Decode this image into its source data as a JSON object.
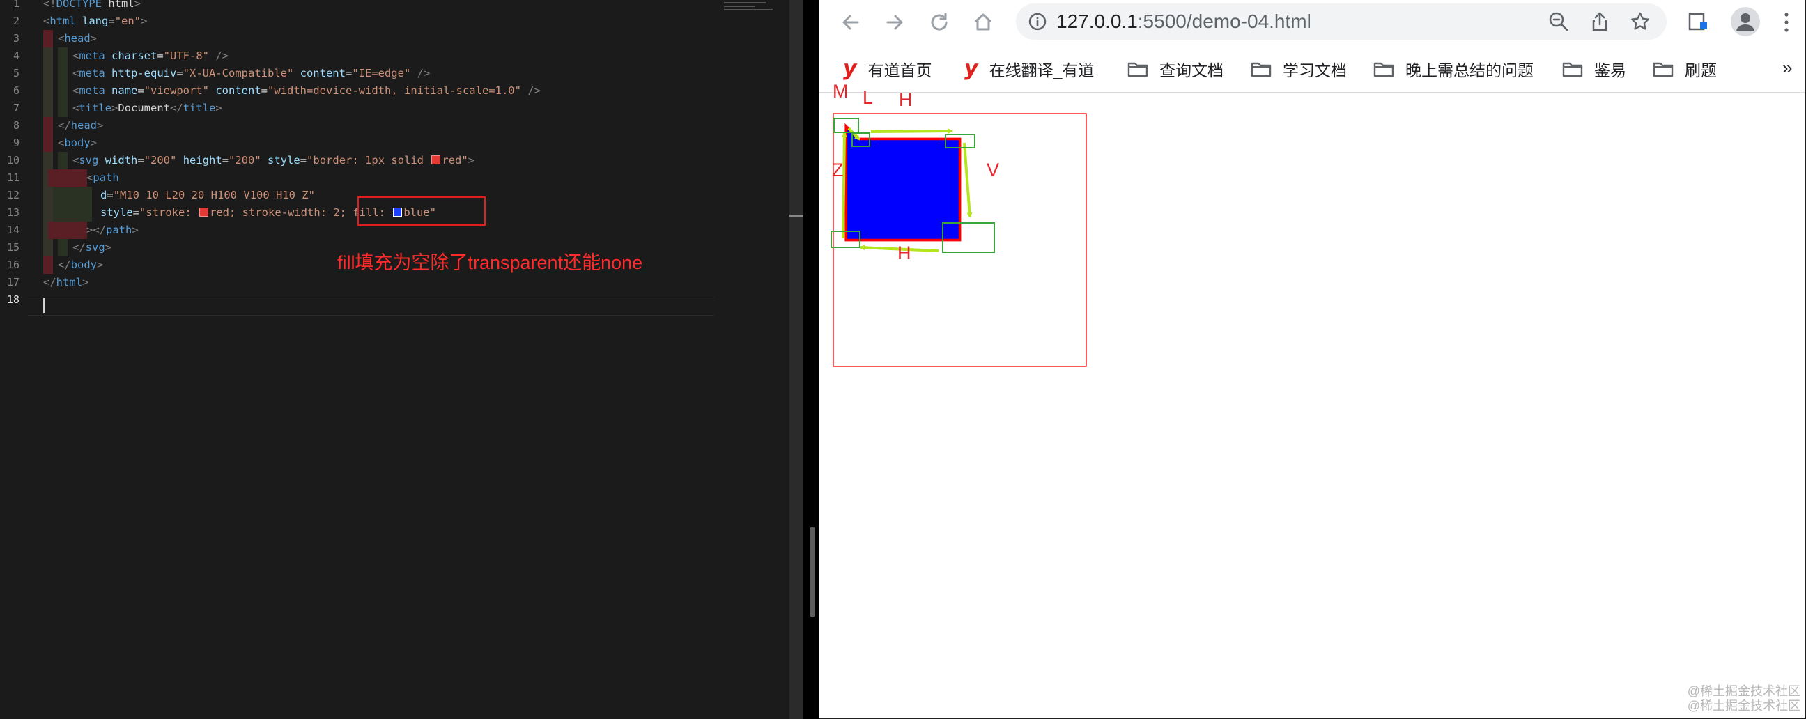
{
  "editor": {
    "lines": [
      {
        "n": "1",
        "parts": [
          [
            "pun",
            "<!"
          ],
          [
            "tag",
            "DOCTYPE"
          ],
          [
            "txt",
            " html"
          ],
          [
            "pun",
            ">"
          ]
        ]
      },
      {
        "n": "2",
        "parts": [
          [
            "pun",
            "<"
          ],
          [
            "tag",
            "html"
          ],
          [
            "attr",
            " lang"
          ],
          [
            "txt",
            "="
          ],
          [
            "str",
            "\"en\""
          ],
          [
            "pun",
            ">"
          ]
        ]
      },
      {
        "n": "3",
        "parts": [
          [
            "pun",
            "<"
          ],
          [
            "tag",
            "head"
          ],
          [
            "pun",
            ">"
          ]
        ]
      },
      {
        "n": "4",
        "parts": [
          [
            "pun",
            "<"
          ],
          [
            "tag",
            "meta"
          ],
          [
            "attr",
            " charset"
          ],
          [
            "txt",
            "="
          ],
          [
            "str",
            "\"UTF-8\""
          ],
          [
            "pun",
            " />"
          ]
        ]
      },
      {
        "n": "5",
        "parts": [
          [
            "pun",
            "<"
          ],
          [
            "tag",
            "meta"
          ],
          [
            "attr",
            " http-equiv"
          ],
          [
            "txt",
            "="
          ],
          [
            "str",
            "\"X-UA-Compatible\""
          ],
          [
            "attr",
            " content"
          ],
          [
            "txt",
            "="
          ],
          [
            "str",
            "\"IE=edge\""
          ],
          [
            "pun",
            " />"
          ]
        ]
      },
      {
        "n": "6",
        "parts": [
          [
            "pun",
            "<"
          ],
          [
            "tag",
            "meta"
          ],
          [
            "attr",
            " name"
          ],
          [
            "txt",
            "="
          ],
          [
            "str",
            "\"viewport\""
          ],
          [
            "attr",
            " content"
          ],
          [
            "txt",
            "="
          ],
          [
            "str",
            "\"width=device-width, initial-scale=1.0\""
          ],
          [
            "pun",
            " />"
          ]
        ]
      },
      {
        "n": "7",
        "parts": [
          [
            "pun",
            "<"
          ],
          [
            "tag",
            "title"
          ],
          [
            "pun",
            ">"
          ],
          [
            "txt",
            "Document"
          ],
          [
            "pun",
            "</"
          ],
          [
            "tag",
            "title"
          ],
          [
            "pun",
            ">"
          ]
        ]
      },
      {
        "n": "8",
        "parts": [
          [
            "pun",
            "</"
          ],
          [
            "tag",
            "head"
          ],
          [
            "pun",
            ">"
          ]
        ]
      },
      {
        "n": "9",
        "parts": [
          [
            "pun",
            "<"
          ],
          [
            "tag",
            "body"
          ],
          [
            "pun",
            ">"
          ]
        ]
      },
      {
        "n": "10",
        "parts": [
          [
            "pun",
            "<"
          ],
          [
            "tag",
            "svg"
          ],
          [
            "attr",
            " width"
          ],
          [
            "txt",
            "="
          ],
          [
            "str",
            "\"200\""
          ],
          [
            "attr",
            " height"
          ],
          [
            "txt",
            "="
          ],
          [
            "str",
            "\"200\""
          ],
          [
            "attr",
            " style"
          ],
          [
            "txt",
            "="
          ],
          [
            "str",
            "\"border: 1px solid "
          ],
          [
            "swatch",
            "red"
          ],
          [
            "str",
            "red\""
          ],
          [
            "pun",
            ">"
          ]
        ]
      },
      {
        "n": "11",
        "parts": [
          [
            "pun",
            "<"
          ],
          [
            "tag",
            "path"
          ]
        ]
      },
      {
        "n": "12",
        "parts": [
          [
            "attr",
            "d"
          ],
          [
            "txt",
            "="
          ],
          [
            "str",
            "\"M10 10 L20 20 H100 V100 H10 Z\""
          ]
        ]
      },
      {
        "n": "13",
        "parts": [
          [
            "attr",
            "style"
          ],
          [
            "txt",
            "="
          ],
          [
            "str",
            "\"stroke: "
          ],
          [
            "swatch",
            "red"
          ],
          [
            "str",
            "red; stroke-width: 2; fill: "
          ],
          [
            "swatch",
            "blue"
          ],
          [
            "str",
            "blue\""
          ]
        ]
      },
      {
        "n": "14",
        "parts": [
          [
            "pun",
            "></"
          ],
          [
            "tag",
            "path"
          ],
          [
            "pun",
            ">"
          ]
        ]
      },
      {
        "n": "15",
        "parts": [
          [
            "pun",
            "</"
          ],
          [
            "tag",
            "svg"
          ],
          [
            "pun",
            ">"
          ]
        ]
      },
      {
        "n": "16",
        "parts": [
          [
            "pun",
            "</"
          ],
          [
            "tag",
            "body"
          ],
          [
            "pun",
            ">"
          ]
        ]
      },
      {
        "n": "17",
        "parts": [
          [
            "pun",
            "</"
          ],
          [
            "tag",
            "html"
          ],
          [
            "pun",
            ">"
          ]
        ]
      },
      {
        "n": "18",
        "parts": []
      }
    ],
    "active_line": "18",
    "annotation_text": "fill填充为空除了transparent还能none"
  },
  "browser": {
    "url_host": "127.0.0.1",
    "url_path": ":5500/demo-04.html",
    "bookmarks": [
      {
        "label": "有道首页",
        "icon": "youdao-logo"
      },
      {
        "label": "在线翻译_有道",
        "icon": "youdao-logo"
      },
      {
        "label": "查询文档",
        "icon": "folder-icon"
      },
      {
        "label": "学习文档",
        "icon": "folder-icon"
      },
      {
        "label": "晚上需总结的问题",
        "icon": "folder-icon"
      },
      {
        "label": "鉴易",
        "icon": "folder-icon"
      },
      {
        "label": "刷题",
        "icon": "folder-icon"
      }
    ],
    "bookmarks_more": "»",
    "youdao_glyph": "y"
  },
  "demo": {
    "labels": {
      "m": "M",
      "l": "L",
      "h_top": "H",
      "v": "V",
      "z": "Z",
      "h_bottom": "H"
    },
    "colors": {
      "stroke": "#ff0000",
      "fill": "#0000ff",
      "arrow": "#b5e61d",
      "highlight_box": "#3aa63a",
      "border": "#ff0000"
    }
  },
  "watermark": {
    "line1": "@稀土掘金技术社区",
    "line2": "@稀土掘金技术社区"
  }
}
